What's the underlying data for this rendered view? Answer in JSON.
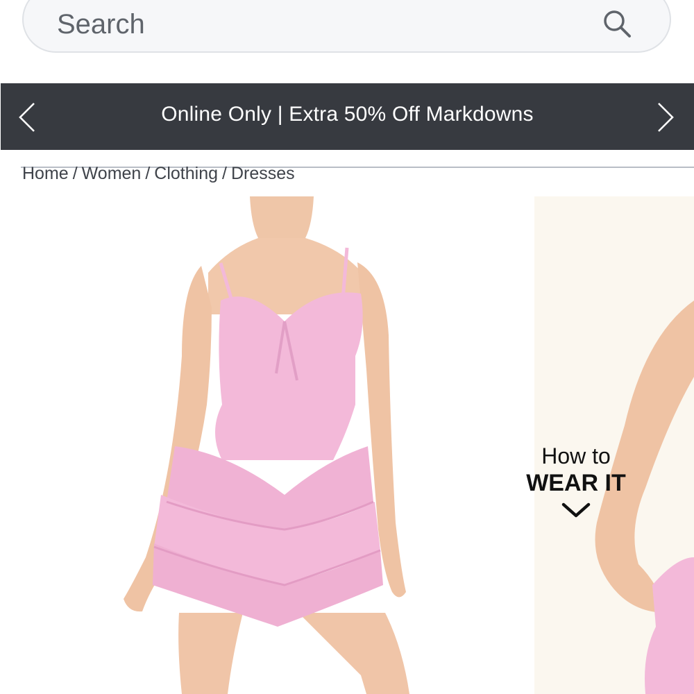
{
  "search": {
    "placeholder": "Search",
    "icon": "search-icon"
  },
  "promo_banner": {
    "text": "Online Only | Extra 50% Off Markdowns",
    "background": "#373a40",
    "prev_icon": "chevron-left-icon",
    "next_icon": "chevron-right-icon"
  },
  "breadcrumb": {
    "items": [
      "Home",
      "Women",
      "Clothing",
      "Dresses"
    ],
    "separator": "/"
  },
  "product": {
    "dress_color": "#f3b9d9",
    "how_to": {
      "line1": "How to",
      "line2": "WEAR IT",
      "icon": "chevron-down-icon"
    }
  }
}
